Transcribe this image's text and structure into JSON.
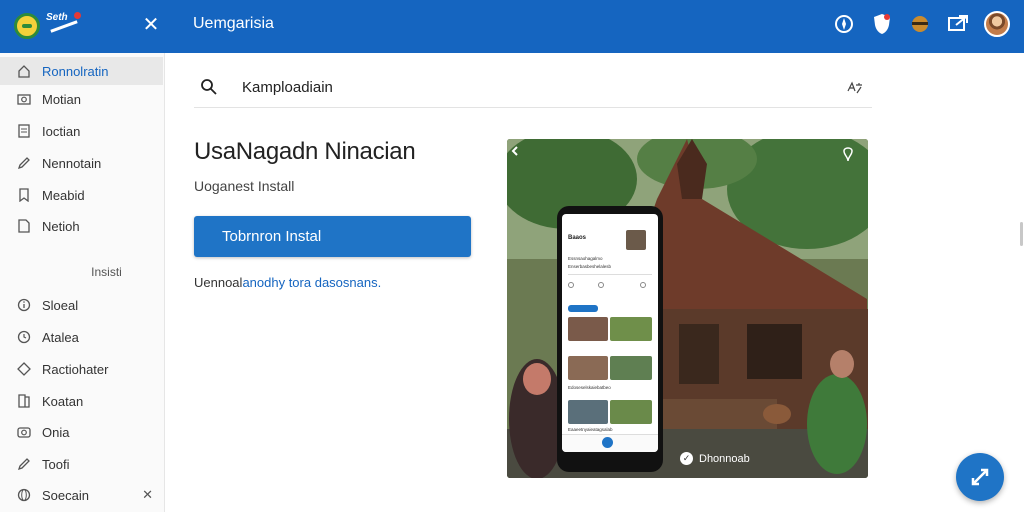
{
  "topbar": {
    "title": "Uemgarisia",
    "brand_text": "Seth",
    "icons": [
      "compass-icon",
      "shield-icon",
      "cloud-icon",
      "share-screen-icon",
      "avatar"
    ],
    "color": "#1565c0"
  },
  "sidebar": {
    "items_top": [
      {
        "label": "Ronnolratin",
        "icon": "home-icon",
        "active": true
      },
      {
        "label": "Motian",
        "icon": "camera-icon",
        "active": false
      },
      {
        "label": "Ioctian",
        "icon": "document-icon",
        "active": false
      },
      {
        "label": "Nennotain",
        "icon": "pencil-icon",
        "active": false
      },
      {
        "label": "Meabid",
        "icon": "bookmark-icon",
        "active": false
      },
      {
        "label": "Netioh",
        "icon": "file-icon",
        "active": false
      }
    ],
    "section_label": "Insisti",
    "items_bottom": [
      {
        "label": "Sloeal",
        "icon": "info-icon"
      },
      {
        "label": "Atalea",
        "icon": "clock-icon"
      },
      {
        "label": "Ractiohater",
        "icon": "tag-icon"
      },
      {
        "label": "Koatan",
        "icon": "book-icon"
      },
      {
        "label": "Onia",
        "icon": "camera-icon"
      },
      {
        "label": "Toofi",
        "icon": "pencil-icon"
      },
      {
        "label": "Soecain",
        "icon": "globe-icon"
      }
    ]
  },
  "search": {
    "value": "Kamploadiain"
  },
  "main": {
    "headline": "UsaNagadn Ninacian",
    "subline": "Uoganest Install",
    "primary_button": "Tobrnron Instal",
    "link_prefix": "Uennoal",
    "link_text": "anodhy tora dasosnans."
  },
  "hero": {
    "caption": "Dhonnoab",
    "phone": {
      "title": "Baaos",
      "lines": [
        "Essnsaohagalmo",
        "Enserbasbeshelalesb",
        "Edoseselskaiebatbeo",
        "Eaaeetnyaieatagsalab"
      ]
    }
  },
  "colors": {
    "accent": "#1f74c6",
    "link": "#1565c0"
  }
}
